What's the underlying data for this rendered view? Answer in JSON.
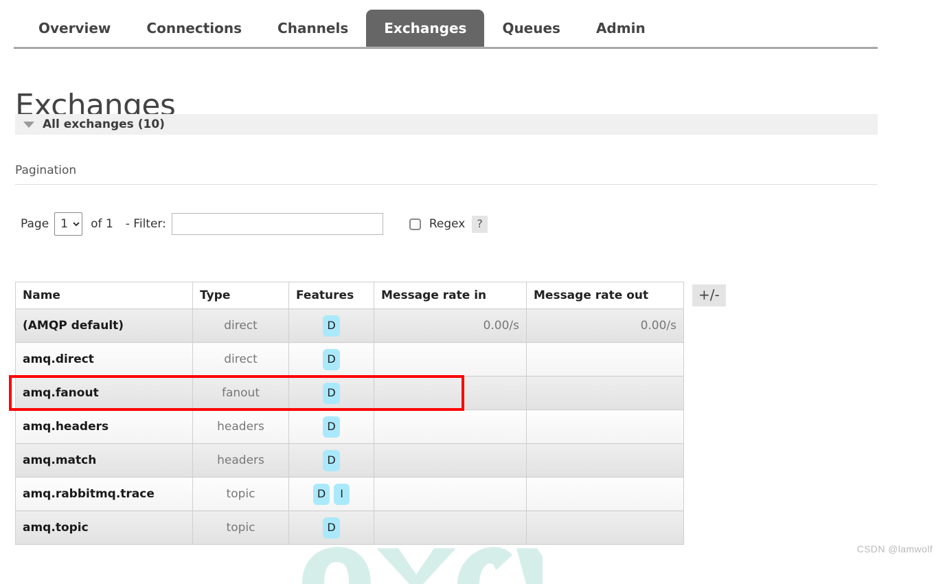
{
  "nav": {
    "tabs": [
      {
        "label": "Overview",
        "active": false
      },
      {
        "label": "Connections",
        "active": false
      },
      {
        "label": "Channels",
        "active": false
      },
      {
        "label": "Exchanges",
        "active": true
      },
      {
        "label": "Queues",
        "active": false
      },
      {
        "label": "Admin",
        "active": false
      }
    ]
  },
  "page": {
    "title": "Exchanges",
    "section_label": "All exchanges (10)",
    "section_arrow_icon": "triangle-down-icon"
  },
  "pagination": {
    "heading": "Pagination",
    "page_label": "Page",
    "page_value": "1",
    "page_options": [
      "1"
    ],
    "of_label": "of 1",
    "filter_label": "- Filter:",
    "filter_value": "",
    "filter_placeholder": "",
    "regex_label": "Regex",
    "regex_checked": false,
    "help_label": "?"
  },
  "table": {
    "columns": [
      "Name",
      "Type",
      "Features",
      "Message rate in",
      "Message rate out"
    ],
    "plus_minus_label": "+/-",
    "rows": [
      {
        "name": "(AMQP default)",
        "type": "direct",
        "features": [
          "D"
        ],
        "rate_in": "0.00/s",
        "rate_out": "0.00/s"
      },
      {
        "name": "amq.direct",
        "type": "direct",
        "features": [
          "D"
        ],
        "rate_in": "",
        "rate_out": ""
      },
      {
        "name": "amq.fanout",
        "type": "fanout",
        "features": [
          "D"
        ],
        "rate_in": "",
        "rate_out": ""
      },
      {
        "name": "amq.headers",
        "type": "headers",
        "features": [
          "D"
        ],
        "rate_in": "",
        "rate_out": ""
      },
      {
        "name": "amq.match",
        "type": "headers",
        "features": [
          "D"
        ],
        "rate_in": "",
        "rate_out": ""
      },
      {
        "name": "amq.rabbitmq.trace",
        "type": "topic",
        "features": [
          "D",
          "I"
        ],
        "rate_in": "",
        "rate_out": ""
      },
      {
        "name": "amq.topic",
        "type": "topic",
        "features": [
          "D"
        ],
        "rate_in": "",
        "rate_out": ""
      }
    ]
  },
  "annotation": {
    "target_row": "amq.fanout",
    "color": "#fe0000"
  },
  "watermark": {
    "text": "CSDN @lamwolf",
    "graphic_color": "#d6eeea"
  },
  "colors": {
    "active_tab_bg": "#666666",
    "feature_badge_bg": "#aae9fb",
    "band_bg": "#f0f0f0",
    "row_alt_bg": "#e4e4e4"
  }
}
